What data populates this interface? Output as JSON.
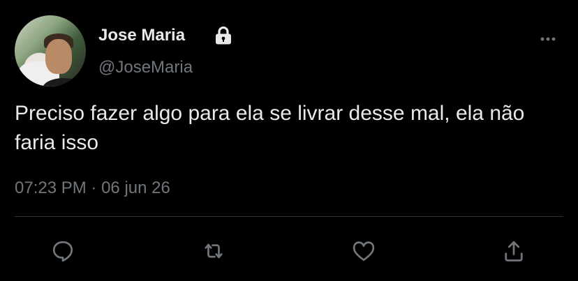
{
  "tweet": {
    "author_name": "Jose Maria",
    "author_handle": "@JoseMaria",
    "text": "Preciso fazer algo para ela se livrar desse mal, ela não faria isso",
    "time": "07:23 PM",
    "separator": "·",
    "date": "06 jun 26"
  },
  "icons": {
    "lock": "lock-icon",
    "more": "more-horizontal-icon",
    "reply": "reply-icon",
    "retweet": "retweet-icon",
    "like": "heart-icon",
    "share": "share-icon"
  },
  "colors": {
    "background": "#000000",
    "primary_text": "#e7e9ea",
    "secondary_text": "#71767b",
    "divider": "#2f3336"
  }
}
